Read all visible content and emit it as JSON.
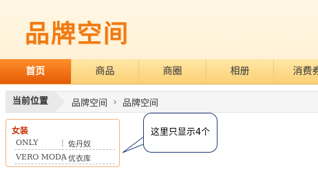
{
  "header": {
    "logo_text": "品牌空间"
  },
  "nav": {
    "items": [
      {
        "label": "首页",
        "active": true
      },
      {
        "label": "商品"
      },
      {
        "label": "商圈"
      },
      {
        "label": "相册"
      },
      {
        "label": "消费券"
      }
    ]
  },
  "breadcrumb": {
    "current_label": "当前位置",
    "path": [
      "品牌空间",
      "品牌空间"
    ]
  },
  "brand_box": {
    "category": "女装",
    "brands": [
      "ONLY",
      "佐丹奴",
      "VERO MODA",
      "优衣库"
    ]
  },
  "callout": {
    "text": "这里只显示4个"
  },
  "colors": {
    "accent": "#f07a12",
    "nav_active": "#e35b04",
    "category": "#c8310a"
  }
}
